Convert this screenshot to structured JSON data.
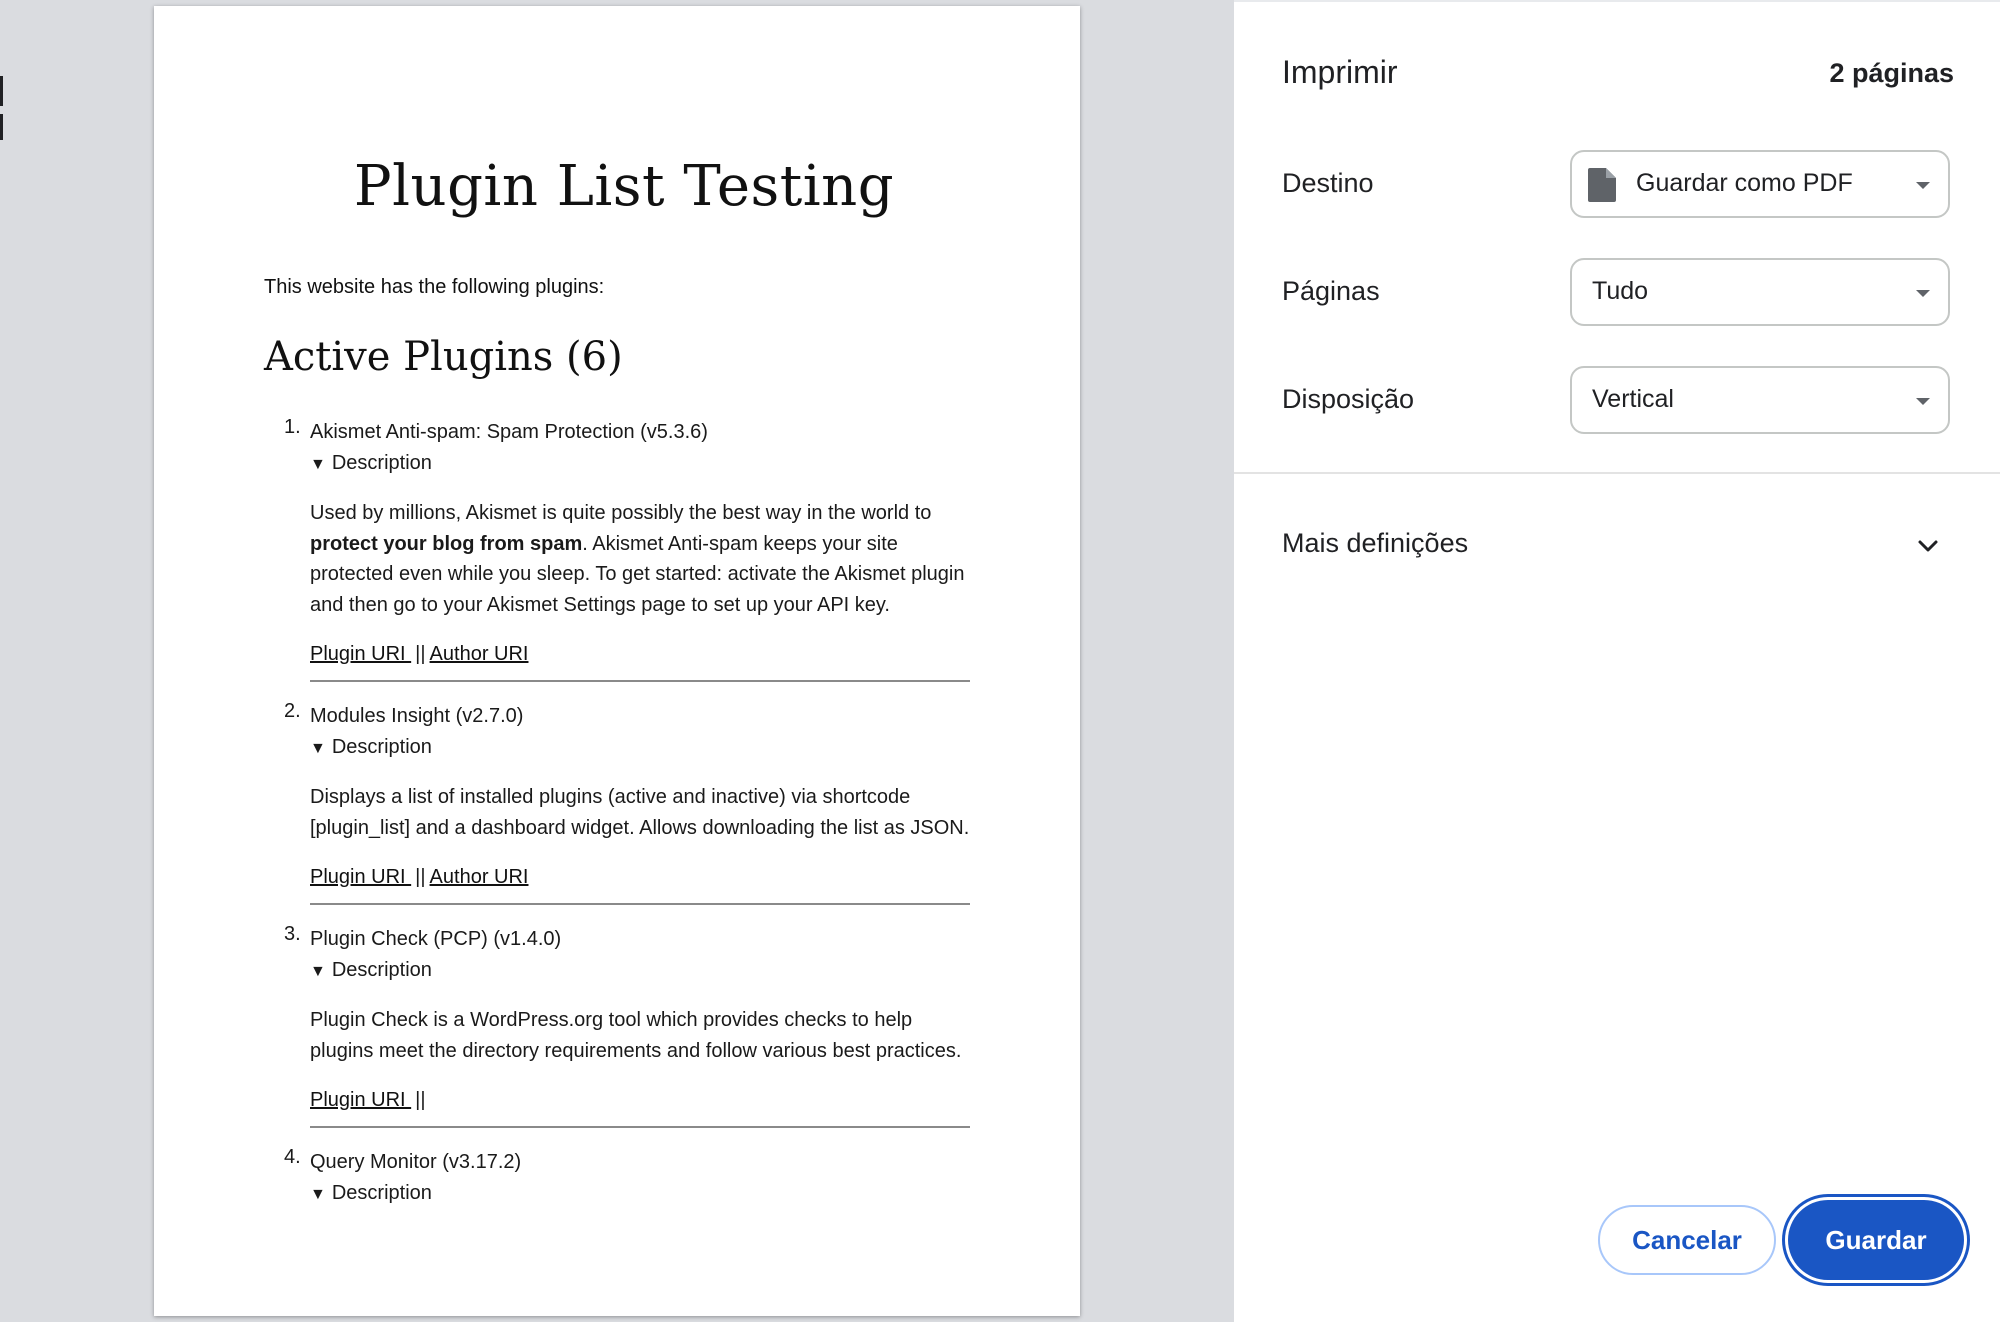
{
  "document": {
    "title": "Plugin List Testing",
    "intro": "This website has the following plugins:",
    "section_heading": "Active Plugins (6)",
    "plugins": [
      {
        "num": "1.",
        "name": "Akismet Anti-spam: Spam Protection (v5.3.6)",
        "summary": "Description",
        "desc_before": "Used by millions, Akismet is quite possibly the best way in the world to ",
        "desc_bold": "protect your blog from spam",
        "desc_after": ". Akismet Anti-spam keeps your site protected even while you sleep. To get started: activate the Akismet plugin and then go to your Akismet Settings page to set up your API key.",
        "plugin_uri": "Plugin URI ",
        "separator": "||",
        "author_uri": "Author URI"
      },
      {
        "num": "2.",
        "name": "Modules Insight (v2.7.0)",
        "summary": "Description",
        "desc": "Displays a list of installed plugins (active and inactive) via shortcode [plugin_list] and a dashboard widget. Allows downloading the list as JSON.",
        "plugin_uri": "Plugin URI ",
        "separator": "||",
        "author_uri": "Author URI"
      },
      {
        "num": "3.",
        "name": "Plugin Check (PCP) (v1.4.0)",
        "summary": "Description",
        "desc": "Plugin Check is a WordPress.org tool which provides checks to help plugins meet the directory requirements and follow various best practices.",
        "plugin_uri": "Plugin URI ",
        "separator": "||"
      },
      {
        "num": "4.",
        "name": "Query Monitor (v3.17.2)",
        "summary": "Description"
      }
    ]
  },
  "panel": {
    "title": "Imprimir",
    "page_count": "2 páginas",
    "destination": {
      "label": "Destino",
      "value": "Guardar como PDF",
      "icon": "document-icon"
    },
    "pages": {
      "label": "Páginas",
      "value": "Tudo"
    },
    "layout": {
      "label": "Disposição",
      "value": "Vertical"
    },
    "more_settings": "Mais definições",
    "cancel_label": "Cancelar",
    "save_label": "Guardar"
  },
  "colors": {
    "accent": "#1a56c4",
    "preview_bg": "#dadce0",
    "cancel_border": "#a8c7fa"
  }
}
